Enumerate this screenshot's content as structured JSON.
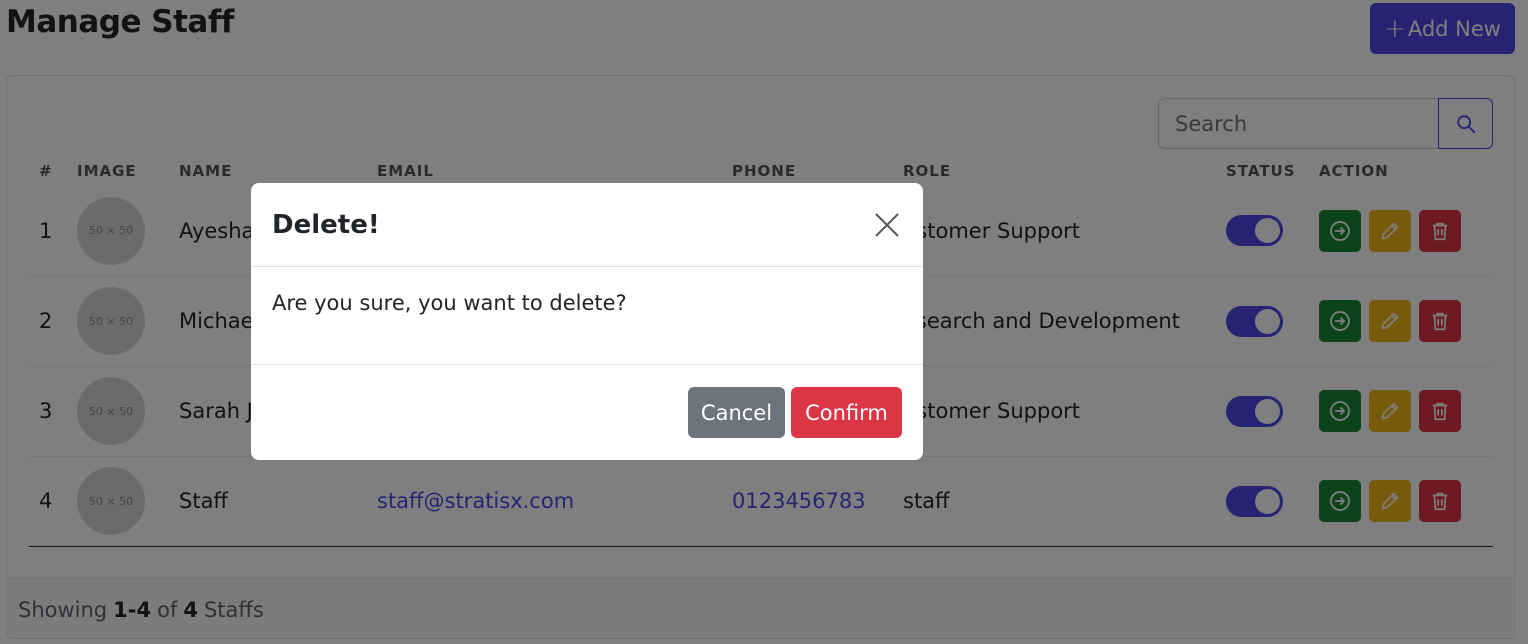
{
  "header": {
    "title": "Manage Staff",
    "add_button": {
      "icon": "+",
      "label": "Add New"
    }
  },
  "search": {
    "placeholder": "Search"
  },
  "table": {
    "columns": [
      "#",
      "IMAGE",
      "NAME",
      "EMAIL",
      "PHONE",
      "ROLE",
      "STATUS",
      "ACTION"
    ],
    "rows": [
      {
        "num": "1",
        "image": "50 × 50",
        "name": "Ayesha",
        "email": "",
        "phone": "",
        "role": "ustomer Support",
        "status": true
      },
      {
        "num": "2",
        "image": "50 × 50",
        "name": "Michael",
        "email": "",
        "phone": "",
        "role": "esearch and Development",
        "status": true
      },
      {
        "num": "3",
        "image": "50 × 50",
        "name": "Sarah Jo",
        "email": "",
        "phone": "",
        "role": "ustomer Support",
        "status": true
      },
      {
        "num": "4",
        "image": "50 × 50",
        "name": "Staff",
        "email": "staff@stratisx.com",
        "phone": "0123456783",
        "role": "staff",
        "status": true
      }
    ]
  },
  "footer": {
    "prefix": "Showing",
    "range": "1-4",
    "of": "of",
    "total": "4",
    "suffix": "Staffs"
  },
  "modal": {
    "title": "Delete!",
    "message": "Are you sure, you want to delete?",
    "cancel_label": "Cancel",
    "confirm_label": "Confirm"
  },
  "colors": {
    "primary": "#4f46e5",
    "success": "#198737",
    "warning": "#f0b41a",
    "danger": "#dc3545",
    "secondary": "#6c757d"
  },
  "icons": {
    "search": "search-icon",
    "login": "login-icon",
    "edit": "pencil-icon",
    "delete": "trash-icon",
    "close": "close-icon"
  }
}
